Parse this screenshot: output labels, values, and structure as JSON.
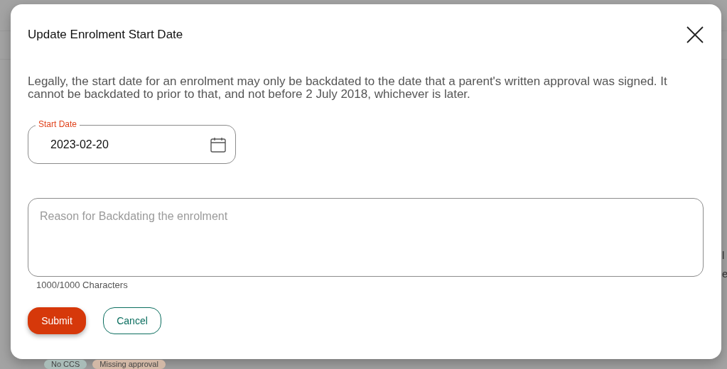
{
  "background": {
    "tags": [
      {
        "label": "No CCS",
        "color": "#a9bcb8"
      },
      {
        "label": "Missing approval",
        "color": "#d2b8a6"
      }
    ],
    "fragments": [
      "l",
      "e"
    ]
  },
  "dialog": {
    "title": "Update Enrolment Start Date",
    "description": "Legally, the start date for an enrolment may only be backdated to the date that a parent's written approval was signed. It cannot be backdated to prior to that, and not before 2 July 2018, whichever is later.",
    "start_date": {
      "label": "Start Date",
      "value": "2023-02-20"
    },
    "reason": {
      "placeholder": "Reason for Backdating the enrolment",
      "counter": "1000/1000 Characters"
    },
    "buttons": [
      {
        "label": "Submit",
        "kind": "primary"
      },
      {
        "label": "Cancel",
        "kind": "outline"
      }
    ]
  }
}
